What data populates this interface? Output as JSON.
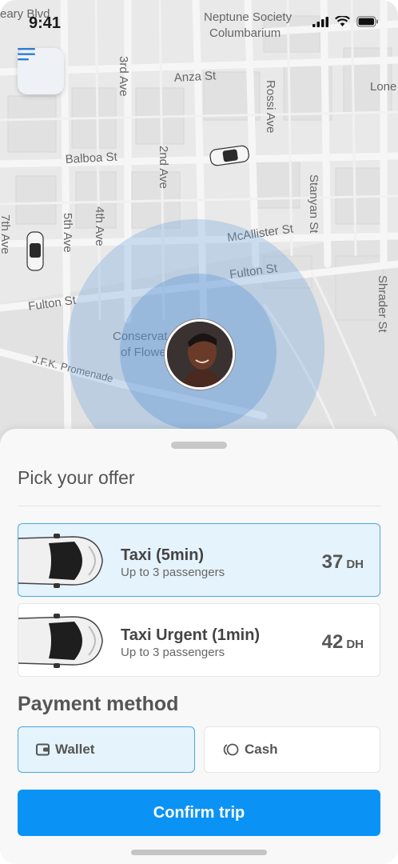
{
  "status_bar": {
    "time": "9:41"
  },
  "map": {
    "labels": {
      "geary": "eary Blvd",
      "neptune_1": "Neptune Society",
      "neptune_2": "Columbarium",
      "anza": "Anza St",
      "third_ave": "3rd Ave",
      "rossi": "Rossi Ave",
      "lone": "Lone",
      "balboa": "Balboa St",
      "second_ave": "2nd Ave",
      "stanyan": "Stanyan St",
      "seventh": "7th Ave",
      "fifth": "5th Ave",
      "fourth": "4th Ave",
      "mcallister": "McAllister St",
      "fulton_right": "Fulton St",
      "fulton_left": "Fulton St",
      "shrader": "Shrader St",
      "conservatory_1": "Conservat",
      "conservatory_2": "of Flowe",
      "jfk": "J.F.K. Promenade"
    }
  },
  "sheet": {
    "title": "Pick your offer",
    "offers": [
      {
        "name": "Taxi (5min)",
        "subtitle": "Up to 3 passengers",
        "price": "37",
        "currency": "DH",
        "selected": true
      },
      {
        "name": "Taxi Urgent (1min)",
        "subtitle": "Up to 3 passengers",
        "price": "42",
        "currency": "DH",
        "selected": false
      }
    ],
    "payment": {
      "title": "Payment method",
      "options": [
        {
          "label": "Wallet",
          "icon": "wallet-icon",
          "selected": true
        },
        {
          "label": "Cash",
          "icon": "coins-icon",
          "selected": false
        }
      ]
    },
    "confirm_label": "Confirm trip"
  },
  "colors": {
    "accent": "#0a93f5",
    "selected_bg": "#e5f3fc",
    "selected_border": "#4aa8e3"
  }
}
